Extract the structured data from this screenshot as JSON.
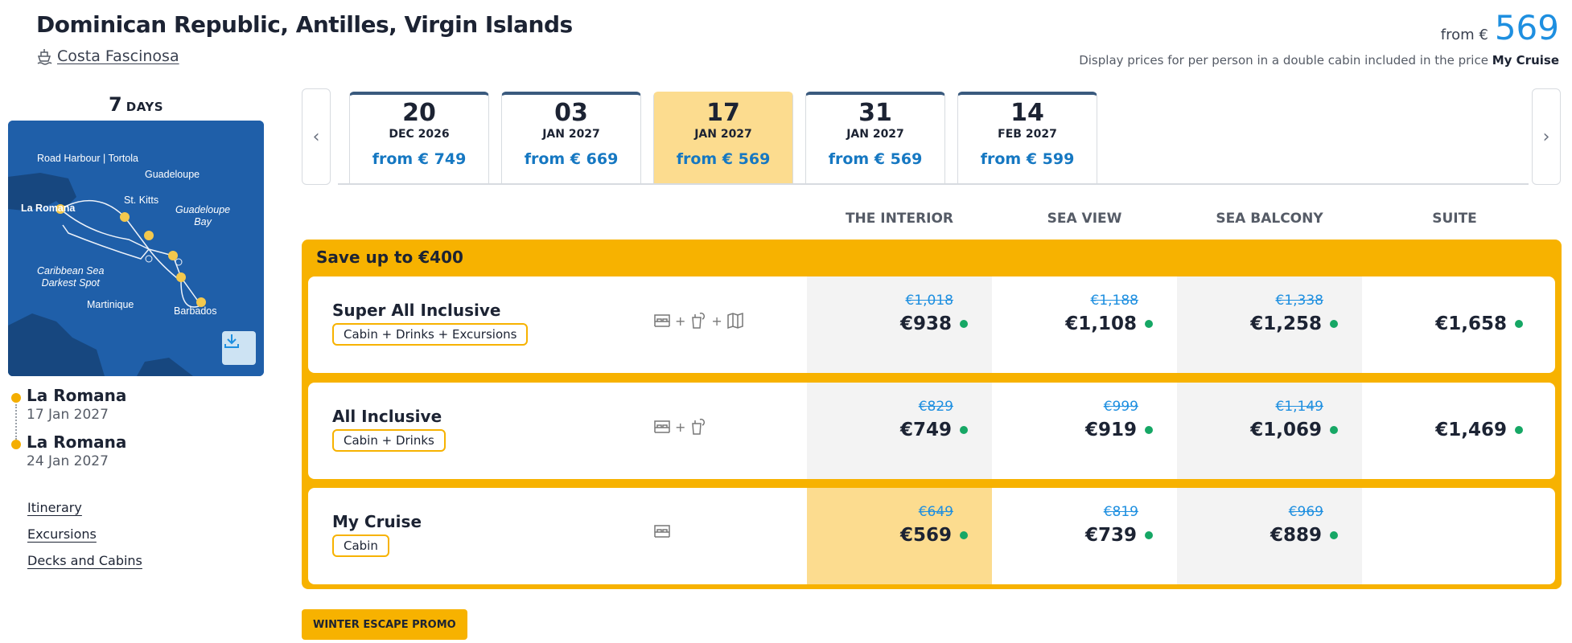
{
  "header": {
    "title": "Dominican Republic, Antilles, Virgin Islands",
    "ship_name": "Costa Fascinosa",
    "from_label": "from €",
    "from_value": "569",
    "disclaimer_prefix": "Display prices for per person in a double cabin included in the price",
    "disclaimer_bold": "My Cruise"
  },
  "trip": {
    "days_num": "7",
    "days_unit": "DAYS",
    "map_labels": {
      "road_harbour": "Road Harbour | Tortola",
      "guadeloupe": "Guadeloupe",
      "st_kitts": "St. Kitts",
      "guadeloupe_bay_1": "Guadeloupe",
      "guadeloupe_bay_2": "Bay",
      "la_romana": "La Romana",
      "caribbean_1": "Caribbean Sea",
      "caribbean_2": "Darkest Spot",
      "martinique": "Martinique",
      "barbados": "Barbados"
    },
    "map_icon": "download-icon",
    "ports": [
      {
        "name": "La Romana",
        "date": "17 Jan 2027"
      },
      {
        "name": "La Romana",
        "date": "24 Jan 2027"
      }
    ],
    "links": [
      "Itinerary",
      "Excursions",
      "Decks and Cabins"
    ]
  },
  "dates": [
    {
      "day": "20",
      "month": "DEC 2026",
      "price": "from € 749"
    },
    {
      "day": "03",
      "month": "JAN 2027",
      "price": "from € 669"
    },
    {
      "day": "17",
      "month": "JAN 2027",
      "price": "from € 569"
    },
    {
      "day": "31",
      "month": "JAN 2027",
      "price": "from € 569"
    },
    {
      "day": "14",
      "month": "FEB 2027",
      "price": "from € 599"
    }
  ],
  "columns": [
    "THE INTERIOR",
    "SEA VIEW",
    "SEA BALCONY",
    "SUITE"
  ],
  "offer": {
    "save_label": "Save up to €400",
    "rows": [
      {
        "name": "Super All Inclusive",
        "tag": "Cabin + Drinks + Excursions",
        "icons": [
          "bed-icon",
          "drink-icon",
          "map-icon"
        ],
        "prices": [
          {
            "old": "€1,018",
            "new": "€938"
          },
          {
            "old": "€1,188",
            "new": "€1,108"
          },
          {
            "old": "€1,338",
            "new": "€1,258"
          },
          {
            "old": "",
            "new": "€1,658"
          }
        ]
      },
      {
        "name": "All Inclusive",
        "tag": "Cabin + Drinks",
        "icons": [
          "bed-icon",
          "drink-icon"
        ],
        "prices": [
          {
            "old": "€829",
            "new": "€749"
          },
          {
            "old": "€999",
            "new": "€919"
          },
          {
            "old": "€1,149",
            "new": "€1,069"
          },
          {
            "old": "",
            "new": "€1,469"
          }
        ]
      },
      {
        "name": "My Cruise",
        "tag": "Cabin",
        "icons": [
          "bed-icon"
        ],
        "prices": [
          {
            "old": "€649",
            "new": "€569"
          },
          {
            "old": "€819",
            "new": "€739"
          },
          {
            "old": "€969",
            "new": "€889"
          },
          {
            "old": "",
            "new": ""
          }
        ]
      }
    ]
  },
  "promo_label": "WINTER ESCAPE PROMO",
  "colors": {
    "accent_yellow": "#f7b200",
    "selected_yellow": "#fcdc8f",
    "price_blue": "#1e8fe0",
    "available_green": "#16a765"
  }
}
